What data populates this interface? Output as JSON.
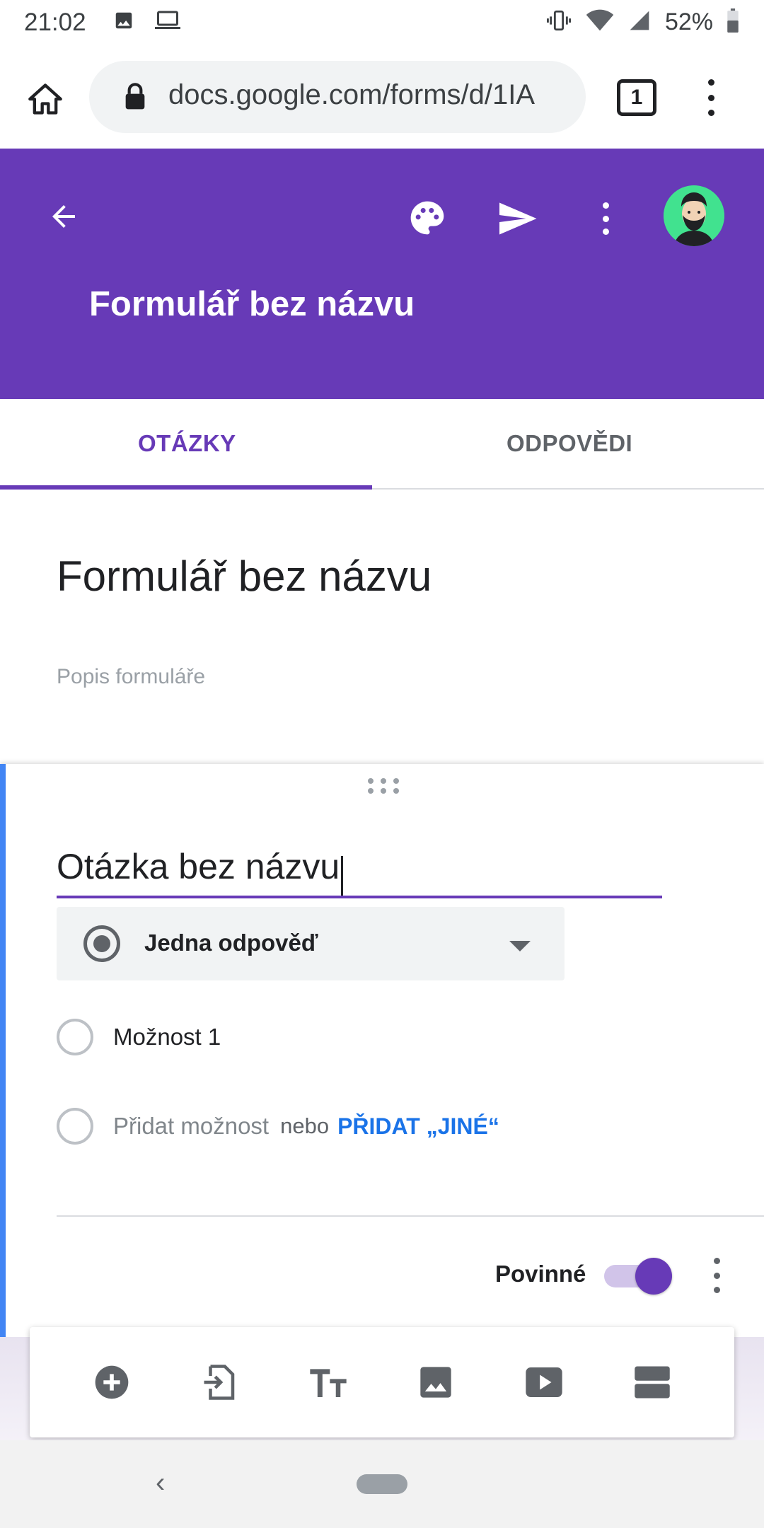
{
  "status_bar": {
    "time": "21:02",
    "left_icons": [
      "image-icon",
      "laptop-icon"
    ],
    "right_icons": [
      "vibrate-icon",
      "wifi-icon",
      "signal-icon"
    ],
    "battery_text": "52%"
  },
  "browser": {
    "url": "docs.google.com/forms/d/1IA",
    "tab_count": "1"
  },
  "header": {
    "title": "Formulář bez názvu",
    "icons": [
      "back-arrow-icon",
      "palette-icon",
      "send-icon",
      "more-vert-icon"
    ],
    "color": "#673ab7"
  },
  "tabs": [
    {
      "label": "OTÁZKY",
      "active": true
    },
    {
      "label": "ODPOVĚDI",
      "active": false
    }
  ],
  "form": {
    "title": "Formulář bez názvu",
    "description_placeholder": "Popis formuláře"
  },
  "question": {
    "title": "Otázka bez názvu",
    "type": "Jedna odpověď",
    "options": [
      "Možnost 1"
    ],
    "add_option": "Přidat možnost",
    "or_text": "nebo",
    "add_other": "PŘIDAT „JINÉ“",
    "required_label": "Povinné",
    "required": true
  },
  "toolbar": {
    "tools": [
      "add-question-icon",
      "import-question-icon",
      "title-text-icon",
      "image-icon",
      "video-icon",
      "section-icon"
    ]
  },
  "colors": {
    "accent": "#673ab7",
    "card_left_accent": "#4285f4",
    "link": "#1a73e8"
  }
}
